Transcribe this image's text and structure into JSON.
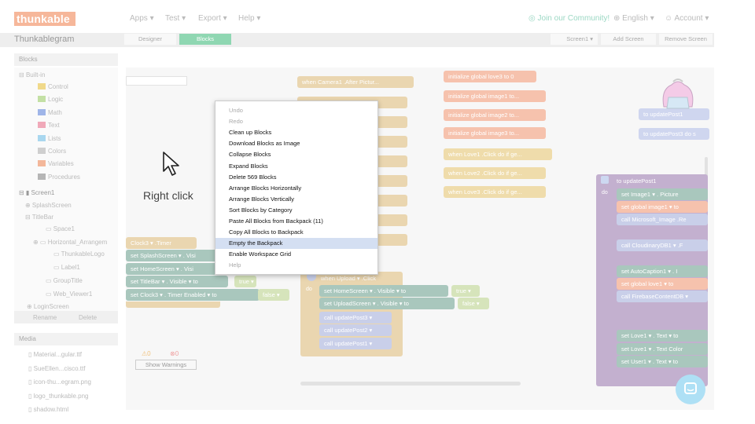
{
  "app": {
    "logo": "thunkable",
    "project_title": "Thunkablegram"
  },
  "nav": {
    "menus": [
      "Apps ▾",
      "Test ▾",
      "Export ▾",
      "Help ▾"
    ],
    "community": "Join our Community!",
    "language": "English ▾",
    "account": "Account ▾"
  },
  "toolbar": {
    "designer_tab": "Designer",
    "blocks_tab": "Blocks",
    "screen_select": "Screen1 ▾",
    "add_screen": "Add Screen",
    "remove_screen": "Remove Screen"
  },
  "blocks_panel": {
    "title": "Blocks",
    "builtin": "Built-in",
    "categories": [
      {
        "label": "Control",
        "color": "#f0d98a"
      },
      {
        "label": "Logic",
        "color": "#c3e0a4"
      },
      {
        "label": "Math",
        "color": "#9fb5e8"
      },
      {
        "label": "Text",
        "color": "#f0a9b9"
      },
      {
        "label": "Lists",
        "color": "#a9d7ef"
      },
      {
        "label": "Colors",
        "color": "#cfcfcf"
      },
      {
        "label": "Variables",
        "color": "#f3b79a"
      },
      {
        "label": "Procedures",
        "color": "#b5b5b5"
      }
    ],
    "components": [
      "Screen1",
      "SplashScreen",
      "TitleBar",
      "Space1",
      "Horizontal_Arrangem",
      "ThunkableLogo",
      "Label1",
      "GroupTitle",
      "Web_Viewer1",
      "LoginScreen"
    ],
    "rename": "Rename",
    "delete": "Delete"
  },
  "media_panel": {
    "title": "Media",
    "files": [
      "Material...gular.ttf",
      "SueEllen...cisco.ttf",
      "icon-thu...egram.png",
      "logo_thunkable.png",
      "shadow.html"
    ]
  },
  "warnings": {
    "warn_count": "0",
    "error_count": "0",
    "show_warnings": "Show Warnings"
  },
  "context_menu": {
    "items": [
      {
        "label": "Undo",
        "state": "disabled"
      },
      {
        "label": "Redo",
        "state": "disabled"
      },
      {
        "label": "Clean up Blocks",
        "state": "enabled"
      },
      {
        "label": "Download Blocks as Image",
        "state": "enabled"
      },
      {
        "label": "Collapse Blocks",
        "state": "enabled"
      },
      {
        "label": "Expand Blocks",
        "state": "enabled"
      },
      {
        "label": "Delete 569 Blocks",
        "state": "enabled"
      },
      {
        "label": "Arrange Blocks Horizontally",
        "state": "enabled"
      },
      {
        "label": "Arrange Blocks Vertically",
        "state": "enabled"
      },
      {
        "label": "Sort Blocks by Category",
        "state": "enabled"
      },
      {
        "label": "Paste All Blocks from Backpack (11)",
        "state": "enabled"
      },
      {
        "label": "Copy All Blocks to Backpack",
        "state": "enabled"
      },
      {
        "label": "Empty the Backpack",
        "state": "highlighted"
      },
      {
        "label": "Enable Workspace Grid",
        "state": "enabled"
      },
      {
        "label": "Help",
        "state": "disabled"
      }
    ]
  },
  "annotation": {
    "right_click": "Right click"
  },
  "blocks": {
    "col1": [
      "when Camera1 .After Pictur...",
      "",
      "",
      "",
      "",
      "",
      "",
      "",
      ""
    ],
    "col2": [
      "initialize global love3 to 0",
      "initialize global image1 to...",
      "initialize global image2 to...",
      "initialize global image3 to...",
      "when Love1 .Click do if ge...",
      "when Love2 .Click do if ge...",
      "when Love3 .Click do if ge..."
    ],
    "right_top": [
      "to updatePost1",
      "to updatePost3 do s"
    ],
    "left_stack": [
      "Clock3 ▾ .Timer",
      "set SplashScreen ▾ . Visi",
      "set HomeScreen ▾ . Visi",
      "set TitleBar ▾ . Visible ▾ to",
      "true ▾",
      "set Clock3 ▾ . Timer Enabled ▾ to",
      "false ▾"
    ],
    "upload": [
      "when Upload ▾ .Click",
      "set HomeScreen ▾ . Visible ▾ to",
      "true ▾",
      "set UploadScreen ▾ . Visible ▾ to",
      "false ▾",
      "call updatePost3 ▾",
      "call updatePost2 ▾",
      "call updatePost1 ▾"
    ],
    "proc": [
      "to updatePost1",
      "set Image1 ▾ . Picture",
      "set global image1 ▾ to",
      "call Microsoft_Image .Re",
      "call CloudinaryDB1 ▾ .F",
      "set AutoCaption1 ▾ . I",
      "set global love1 ▾ to",
      "call FirebaseContentDB ▾",
      "set Love1 ▾ . Text ▾ to",
      "set Love1 ▾ . Text Color",
      "set User1 ▾ . Text ▾ to"
    ],
    "do": "do"
  }
}
